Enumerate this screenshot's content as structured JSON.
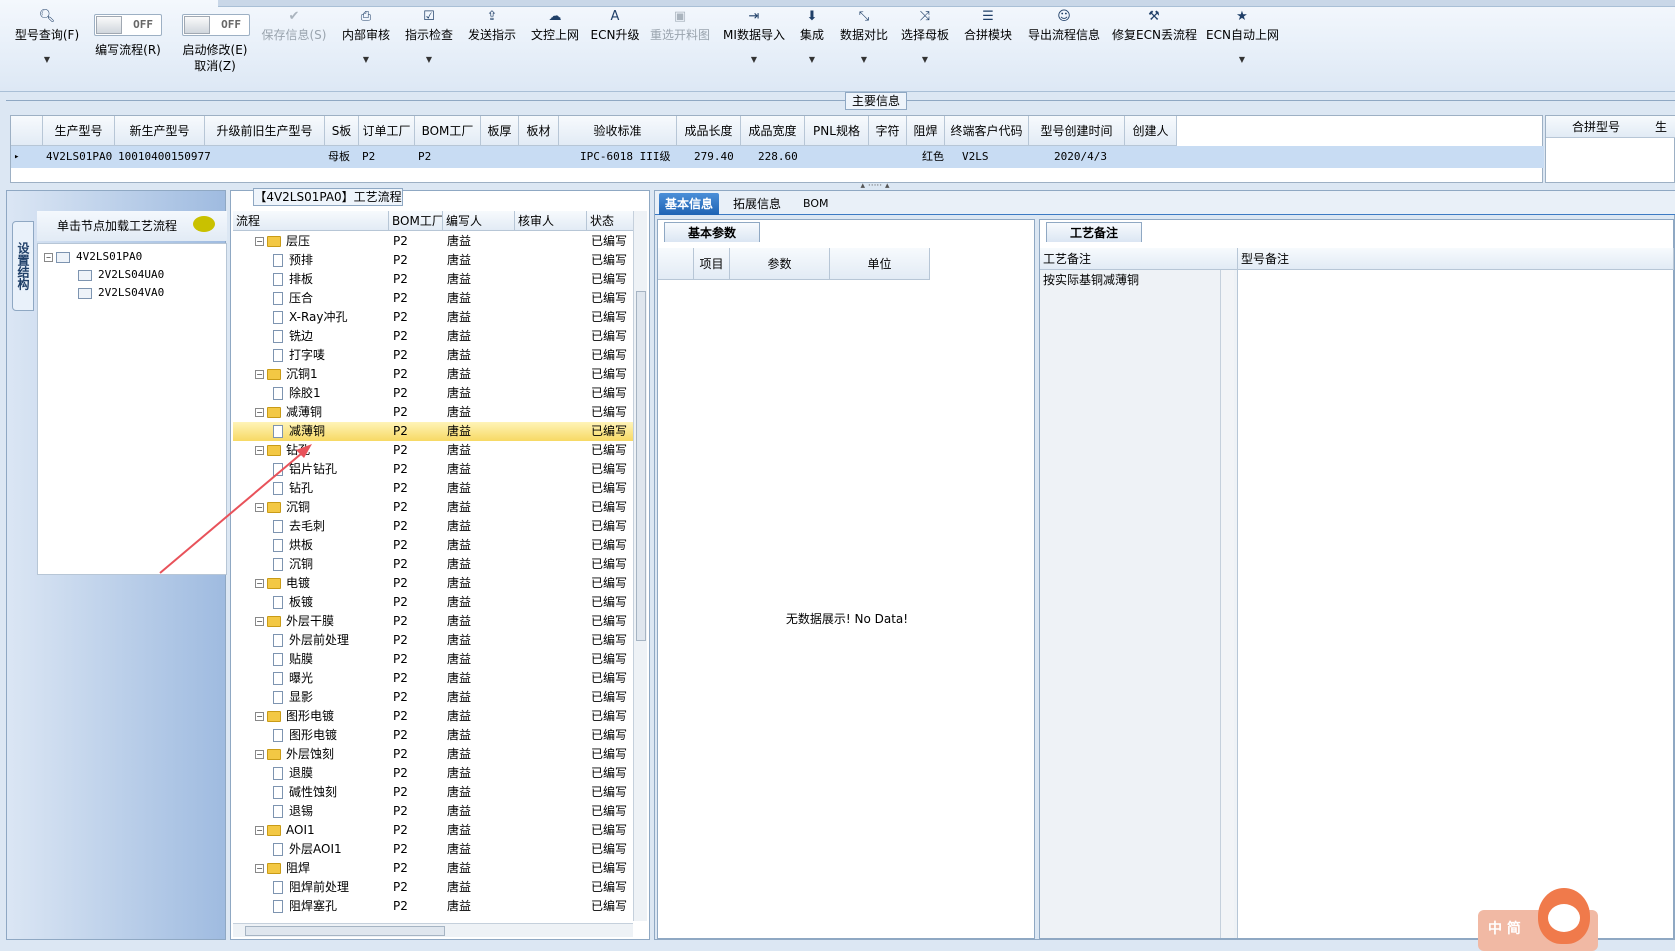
{
  "toolbar": {
    "items": [
      {
        "label": "型号查询(F)",
        "icon": "search-icon",
        "dropdown": true
      },
      {
        "label": "编写流程(R)",
        "toggle": "OFF"
      },
      {
        "label": "启动修改(E)",
        "label2": "取消(Z)",
        "toggle": "OFF"
      },
      {
        "label": "保存信息(S)",
        "icon": "check-icon",
        "disabled": true
      },
      {
        "label": "内部审核",
        "icon": "printer-icon",
        "dropdown": true
      },
      {
        "label": "指示检查",
        "icon": "checkbox-icon",
        "dropdown": true
      },
      {
        "label": "发送指示",
        "icon": "upload-icon"
      },
      {
        "label": "文控上网",
        "icon": "cloud-upload-icon"
      },
      {
        "label": "ECN升级",
        "icon": "letter-a-icon"
      },
      {
        "label": "重选开料图",
        "icon": "image-icon",
        "disabled": true
      },
      {
        "label": "MI数据导入",
        "icon": "import-icon",
        "dropdown": true
      },
      {
        "label": "集成",
        "icon": "download-icon",
        "dropdown": true
      },
      {
        "label": "数据对比",
        "icon": "compress-icon",
        "dropdown": true
      },
      {
        "label": "选择母板",
        "icon": "shuffle-icon",
        "dropdown": true
      },
      {
        "label": "合拼模块",
        "icon": "list-icon"
      },
      {
        "label": "导出流程信息",
        "icon": "smile-icon"
      },
      {
        "label": "修复ECN丢流程",
        "icon": "wrench-icon"
      },
      {
        "label": "ECN自动上网",
        "icon": "star-icon",
        "dropdown": true
      }
    ]
  },
  "main_info": {
    "title": "主要信息",
    "columns": [
      "生产型号",
      "新生产型号",
      "升级前旧生产型号",
      "S板",
      "订单工厂",
      "BOM工厂",
      "板厚",
      "板材",
      "验收标准",
      "成品长度",
      "成品宽度",
      "PNL规格",
      "字符",
      "阻焊",
      "终端客户代码",
      "型号创建时间",
      "创建人"
    ],
    "row": [
      "4V2LS01PA0",
      "10010400150977",
      "",
      "母板",
      "P2",
      "P2",
      "",
      "",
      "IPC-6018 III级",
      "279.40",
      "228.60",
      "",
      "",
      "红色",
      "V2LS",
      "2020/4/3",
      ""
    ],
    "side_columns": [
      "合拼型号",
      "生"
    ]
  },
  "left": {
    "vtab": "设置结构",
    "hint": "单击节点加载工艺流程",
    "tree": [
      {
        "label": "4V2LS01PA0",
        "level": 0
      },
      {
        "label": "2V2LS04UA0",
        "level": 1
      },
      {
        "label": "2V2LS04VA0",
        "level": 1
      }
    ]
  },
  "process": {
    "title": "【4V2LS01PA0】工艺流程",
    "columns": [
      "流程",
      "BOM工厂",
      "编写人",
      "核审人",
      "状态"
    ],
    "rows": [
      {
        "name": "层压",
        "type": "folder",
        "bom": "P2",
        "writer": "唐益",
        "status": "已编写"
      },
      {
        "name": "预排",
        "type": "doc",
        "bom": "P2",
        "writer": "唐益",
        "status": "已编写"
      },
      {
        "name": "排板",
        "type": "doc",
        "bom": "P2",
        "writer": "唐益",
        "status": "已编写"
      },
      {
        "name": "压合",
        "type": "doc",
        "bom": "P2",
        "writer": "唐益",
        "status": "已编写"
      },
      {
        "name": "X-Ray冲孔",
        "type": "doc",
        "bom": "P2",
        "writer": "唐益",
        "status": "已编写"
      },
      {
        "name": "铣边",
        "type": "doc",
        "bom": "P2",
        "writer": "唐益",
        "status": "已编写"
      },
      {
        "name": "打字唛",
        "type": "doc",
        "bom": "P2",
        "writer": "唐益",
        "status": "已编写"
      },
      {
        "name": "沉铜1",
        "type": "folder",
        "bom": "P2",
        "writer": "唐益",
        "status": "已编写"
      },
      {
        "name": "除胶1",
        "type": "doc",
        "bom": "P2",
        "writer": "唐益",
        "status": "已编写"
      },
      {
        "name": "减薄铜",
        "type": "folder",
        "bom": "P2",
        "writer": "唐益",
        "status": "已编写"
      },
      {
        "name": "减薄铜",
        "type": "doc",
        "bom": "P2",
        "writer": "唐益",
        "status": "已编写",
        "selected": true
      },
      {
        "name": "钻孔",
        "type": "folder",
        "bom": "P2",
        "writer": "唐益",
        "status": "已编写"
      },
      {
        "name": "铝片钻孔",
        "type": "doc",
        "bom": "P2",
        "writer": "唐益",
        "status": "已编写"
      },
      {
        "name": "钻孔",
        "type": "doc",
        "bom": "P2",
        "writer": "唐益",
        "status": "已编写"
      },
      {
        "name": "沉铜",
        "type": "folder",
        "bom": "P2",
        "writer": "唐益",
        "status": "已编写"
      },
      {
        "name": "去毛刺",
        "type": "doc",
        "bom": "P2",
        "writer": "唐益",
        "status": "已编写"
      },
      {
        "name": "烘板",
        "type": "doc",
        "bom": "P2",
        "writer": "唐益",
        "status": "已编写"
      },
      {
        "name": "沉铜",
        "type": "doc",
        "bom": "P2",
        "writer": "唐益",
        "status": "已编写"
      },
      {
        "name": "电镀",
        "type": "folder",
        "bom": "P2",
        "writer": "唐益",
        "status": "已编写"
      },
      {
        "name": "板镀",
        "type": "doc",
        "bom": "P2",
        "writer": "唐益",
        "status": "已编写"
      },
      {
        "name": "外层干膜",
        "type": "folder",
        "bom": "P2",
        "writer": "唐益",
        "status": "已编写"
      },
      {
        "name": "外层前处理",
        "type": "doc",
        "bom": "P2",
        "writer": "唐益",
        "status": "已编写"
      },
      {
        "name": "贴膜",
        "type": "doc",
        "bom": "P2",
        "writer": "唐益",
        "status": "已编写"
      },
      {
        "name": "曝光",
        "type": "doc",
        "bom": "P2",
        "writer": "唐益",
        "status": "已编写"
      },
      {
        "name": "显影",
        "type": "doc",
        "bom": "P2",
        "writer": "唐益",
        "status": "已编写"
      },
      {
        "name": "图形电镀",
        "type": "folder",
        "bom": "P2",
        "writer": "唐益",
        "status": "已编写"
      },
      {
        "name": "图形电镀",
        "type": "doc",
        "bom": "P2",
        "writer": "唐益",
        "status": "已编写"
      },
      {
        "name": "外层蚀刻",
        "type": "folder",
        "bom": "P2",
        "writer": "唐益",
        "status": "已编写"
      },
      {
        "name": "退膜",
        "type": "doc",
        "bom": "P2",
        "writer": "唐益",
        "status": "已编写"
      },
      {
        "name": "碱性蚀刻",
        "type": "doc",
        "bom": "P2",
        "writer": "唐益",
        "status": "已编写"
      },
      {
        "name": "退锡",
        "type": "doc",
        "bom": "P2",
        "writer": "唐益",
        "status": "已编写"
      },
      {
        "name": "AOI1",
        "type": "folder",
        "bom": "P2",
        "writer": "唐益",
        "status": "已编写"
      },
      {
        "name": "外层AOI1",
        "type": "doc",
        "bom": "P2",
        "writer": "唐益",
        "status": "已编写"
      },
      {
        "name": "阻焊",
        "type": "folder",
        "bom": "P2",
        "writer": "唐益",
        "status": "已编写"
      },
      {
        "name": "阻焊前处理",
        "type": "doc",
        "bom": "P2",
        "writer": "唐益",
        "status": "已编写"
      },
      {
        "name": "阻焊塞孔",
        "type": "doc",
        "bom": "P2",
        "writer": "唐益",
        "status": "已编写"
      }
    ]
  },
  "right": {
    "tabs": [
      "基本信息",
      "拓展信息",
      "BOM"
    ],
    "basic": {
      "subtab": "基本参数",
      "columns": [
        "项目",
        "参数",
        "单位"
      ],
      "empty": "无数据展示! No Data!"
    },
    "remark": {
      "subtab": "工艺备注",
      "columns": [
        "工艺备注",
        "型号备注"
      ],
      "value": "按实际基铜减薄铜"
    }
  },
  "badge": {
    "text": "中 简"
  },
  "colors": {
    "accent": "#1e63b4",
    "selected_row": "#f7d964",
    "grid_selected": "#c8dcf3",
    "annotation_arrow": "#e8525a"
  }
}
